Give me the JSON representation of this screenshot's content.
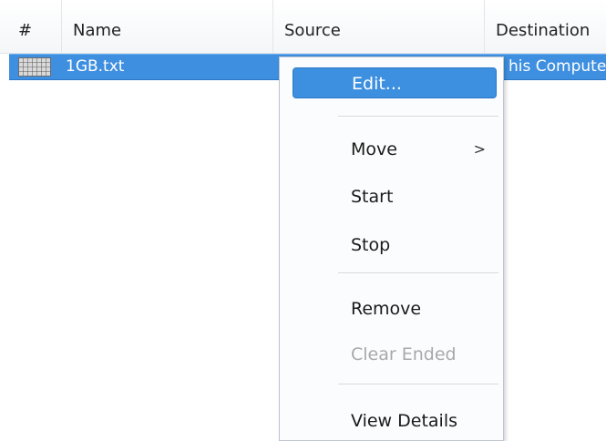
{
  "columns": {
    "num": "#",
    "name": "Name",
    "source": "Source",
    "destination": "Destination"
  },
  "row": {
    "name": "1GB.txt",
    "destination": "his Compute",
    "icon": "file-grid-icon",
    "selected": true
  },
  "menu": {
    "edit": "Edit...",
    "move": "Move",
    "move_arrow": ">",
    "start": "Start",
    "stop": "Stop",
    "remove": "Remove",
    "clear_ended": "Clear Ended",
    "view_details": "View Details"
  },
  "colors": {
    "selection": "#3f8fe0",
    "menu_highlight": "#3d8fdf",
    "disabled_text": "#a9a9a9"
  }
}
